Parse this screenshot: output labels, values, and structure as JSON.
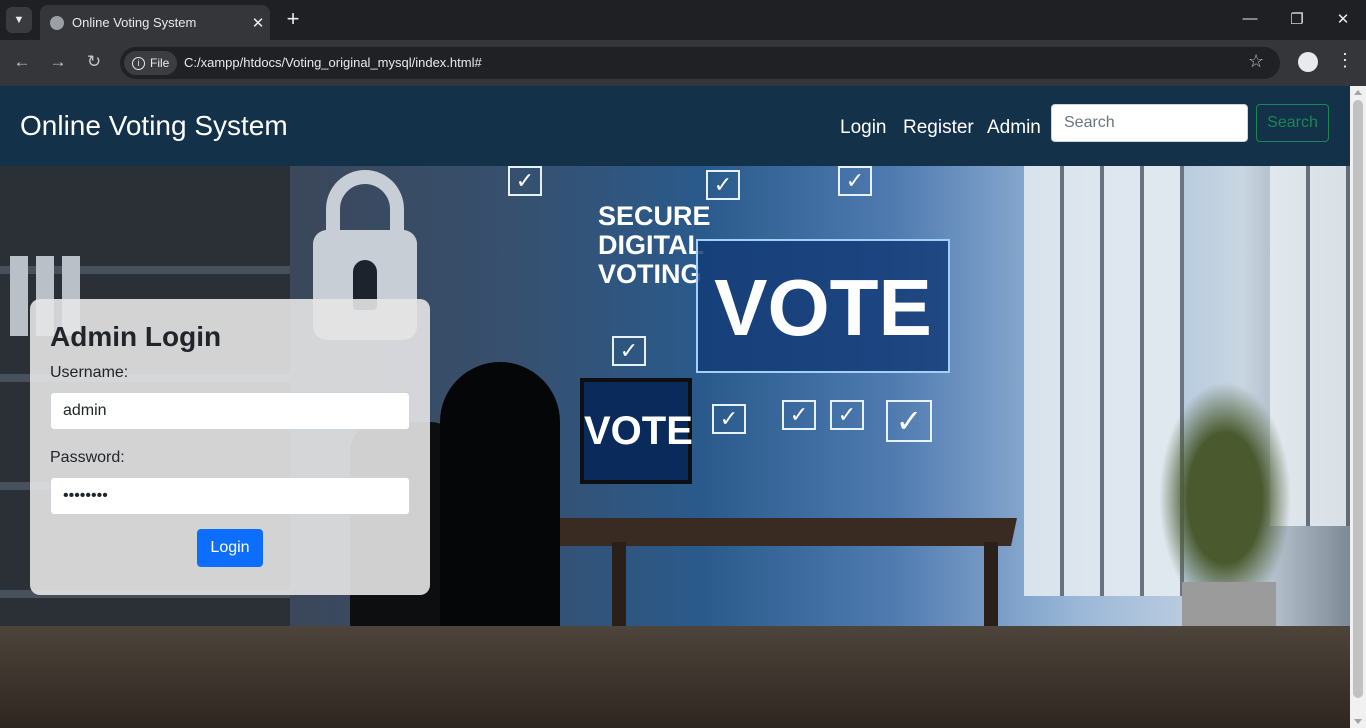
{
  "browser": {
    "tab_title": "Online Voting System",
    "new_tab_label": "+",
    "file_chip": "File",
    "url": "C:/xampp/htdocs/Voting_original_mysql/index.html#"
  },
  "navbar": {
    "brand": "Online Voting System",
    "links": [
      "Login",
      "Register",
      "Admin"
    ],
    "search_placeholder": "Search",
    "search_button": "Search"
  },
  "hero": {
    "signs": {
      "secure": "SECURE",
      "digital": "DIGITAL",
      "voting": "VOTING",
      "vote_big": "VOTE",
      "vote_monitor": "VOTE"
    }
  },
  "login": {
    "title": "Admin Login",
    "username_label": "Username:",
    "username_value": "admin",
    "password_label": "Password:",
    "password_value": "••••••••",
    "button": "Login"
  },
  "colors": {
    "navbar_bg": "#14314a",
    "login_button": "#0d6efd",
    "search_button": "#198754"
  }
}
